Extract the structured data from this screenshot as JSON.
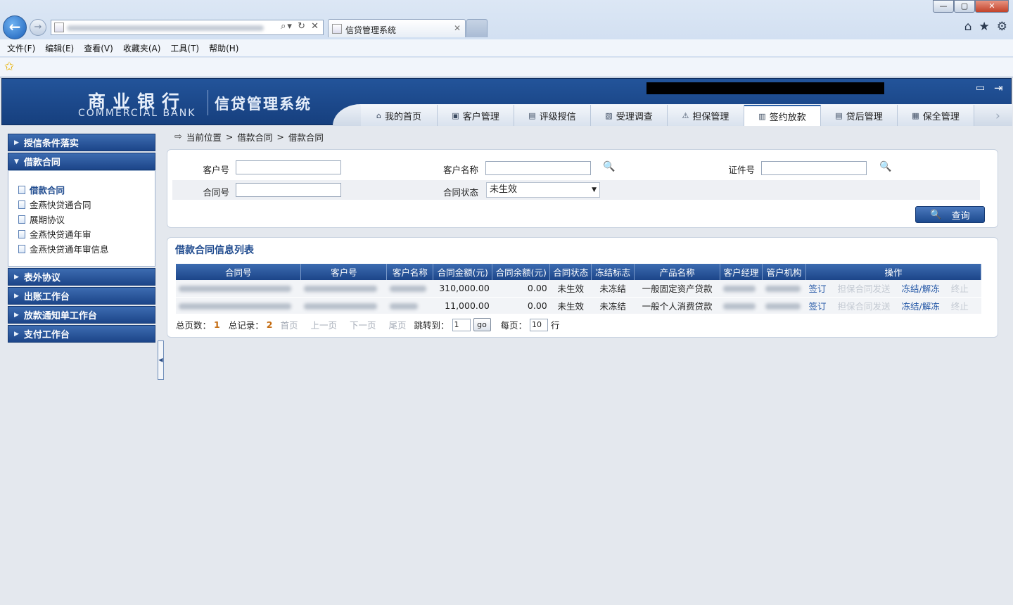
{
  "browser": {
    "window_controls": [
      "—",
      "▢",
      "✕"
    ],
    "tab_title": "信贷管理系统",
    "tab_close": "✕",
    "address_tools": "⌕▾ ↻ ✕",
    "menu": [
      "文件(F)",
      "编辑(E)",
      "查看(V)",
      "收藏夹(A)",
      "工具(T)",
      "帮助(H)"
    ],
    "toolbar_icons": [
      "home-icon",
      "star-icon",
      "gear-icon"
    ]
  },
  "header": {
    "bank_name_cn": "商业银行",
    "bank_name_en": "COMMERCIAL BANK",
    "system_name": "信贷管理系统",
    "tabs": [
      {
        "label": "我的首页",
        "icon": "⌂"
      },
      {
        "label": "客户管理",
        "icon": "▣"
      },
      {
        "label": "评级授信",
        "icon": "▤"
      },
      {
        "label": "受理调查",
        "icon": "▧"
      },
      {
        "label": "担保管理",
        "icon": "⚠"
      },
      {
        "label": "签约放款",
        "icon": "▥",
        "active": true
      },
      {
        "label": "贷后管理",
        "icon": "▤"
      },
      {
        "label": "保全管理",
        "icon": "▦"
      }
    ]
  },
  "sidebar": {
    "section1": "授信条件落实",
    "section2": "借款合同",
    "items": [
      "借款合同",
      "金燕快贷通合同",
      "展期协议",
      "金燕快贷通年审",
      "金燕快贷通年审信息"
    ],
    "section3": "表外协议",
    "section4": "出账工作台",
    "section5": "放款通知单工作台",
    "section6": "支付工作台"
  },
  "breadcrumb": {
    "current": "当前位置",
    "sep1": ">",
    "level1": "借款合同",
    "sep2": ">",
    "level2": "借款合同"
  },
  "search": {
    "customer_no_label": "客户号",
    "customer_name_label": "客户名称",
    "id_no_label": "证件号",
    "contract_no_label": "合同号",
    "status_label": "合同状态",
    "status_value": "未生效",
    "query_button": "查询"
  },
  "list": {
    "title": "借款合同信息列表",
    "columns": [
      "合同号",
      "客户号",
      "客户名称",
      "合同金额(元)",
      "合同余额(元)",
      "合同状态",
      "冻结标志",
      "产品名称",
      "客户经理",
      "管户机构",
      "操作"
    ],
    "rows": [
      {
        "amount": "310,000.00",
        "balance": "0.00",
        "status": "未生效",
        "freeze": "未冻结",
        "product": "一般固定资产贷款"
      },
      {
        "amount": "11,000.00",
        "balance": "0.00",
        "status": "未生效",
        "freeze": "未冻结",
        "product": "一般个人消费贷款"
      }
    ],
    "actions": {
      "sign": "签订",
      "send_guarantee": "担保合同发送",
      "freeze": "冻结/解冻",
      "terminate": "终止"
    }
  },
  "pager": {
    "total_pages_label": "总页数：",
    "total_pages": "1",
    "total_records_label": "总记录：",
    "total_records": "2",
    "first": "首页",
    "prev": "上一页",
    "next": "下一页",
    "last": "尾页",
    "jump_label": "跳转到：",
    "jump_value": "1",
    "go": "go",
    "per_page_label": "每页：",
    "per_page": "10",
    "per_page_unit": "行"
  }
}
